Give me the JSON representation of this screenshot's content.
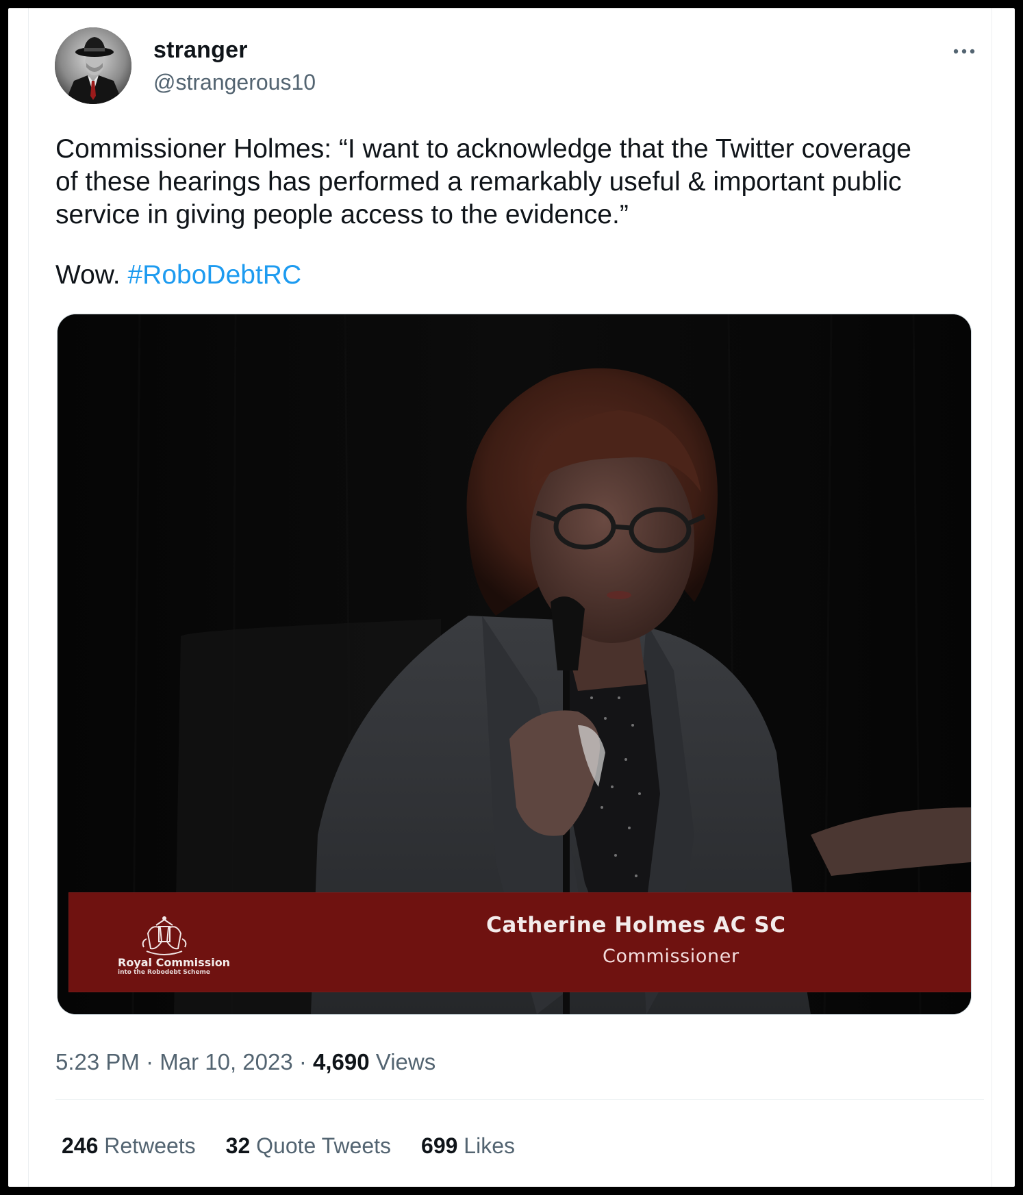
{
  "tweet": {
    "author": {
      "display_name": "stranger",
      "handle": "@strangerous10"
    },
    "more_icon": "more-horizontal-icon",
    "text": "Commissioner Holmes: “I want to acknowledge that the Twitter coverage\nof these hearings has performed a remarkably useful & important public\nservice in giving people access to the evidence.”",
    "text_line2_prefix": "Wow. ",
    "hashtag": "#RoboDebtRC",
    "media": {
      "lower_third_name": "Catherine Holmes AC SC",
      "lower_third_role": "Commissioner",
      "org_name": "Royal Commission",
      "org_subtitle": "into the Robodebt Scheme"
    },
    "time": "5:23 PM",
    "separator": " · ",
    "date": "Mar 10, 2023",
    "views_count": "4,690",
    "views_label": " Views",
    "stats": {
      "retweets_count": "246",
      "retweets_label": " Retweets",
      "quotes_count": "32",
      "quotes_label": " Quote Tweets",
      "likes_count": "699",
      "likes_label": " Likes"
    }
  },
  "colors": {
    "link": "#1d9bf0",
    "text": "#0f1419",
    "secondary": "#536471",
    "lower_third": "#6f1210"
  }
}
